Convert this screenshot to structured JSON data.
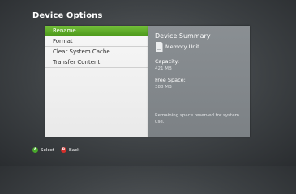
{
  "header": {
    "title": "Device Options"
  },
  "menu": {
    "items": [
      {
        "label": "Rename",
        "selected": true
      },
      {
        "label": "Format",
        "selected": false
      },
      {
        "label": "Clear System Cache",
        "selected": false
      },
      {
        "label": "Transfer Content",
        "selected": false
      }
    ]
  },
  "summary": {
    "title": "Device Summary",
    "device_icon": "memory-unit-icon",
    "device_name": "Memory Unit",
    "capacity_label": "Capacity:",
    "capacity_value": "421 MB",
    "free_label": "Free Space:",
    "free_value": "388 MB",
    "note": "Remaining space reserved for system use."
  },
  "footer": {
    "select_button": "A",
    "select_label": "Select",
    "back_button": "B",
    "back_label": "Back"
  },
  "colors": {
    "accent_green": "#5fab2a",
    "a_button": "#49a82c",
    "b_button": "#d3302c",
    "panel_gray": "#858a8e"
  }
}
